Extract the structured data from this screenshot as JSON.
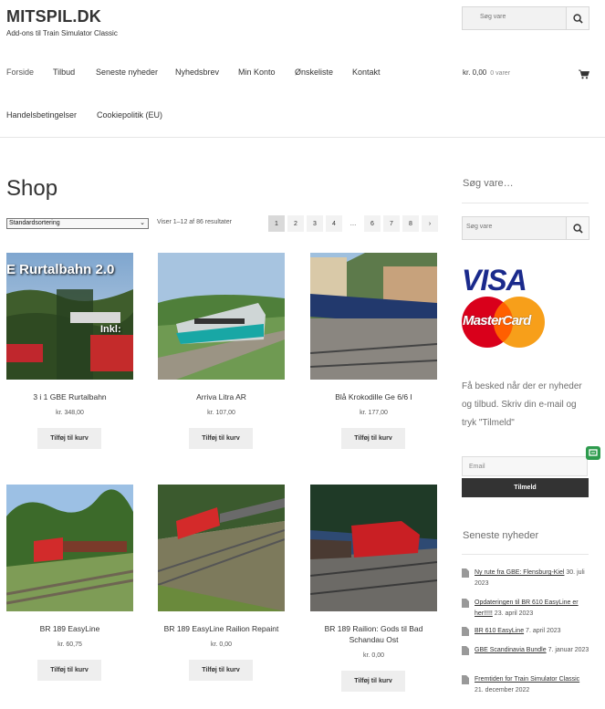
{
  "site": {
    "title": "MITSPIL.DK",
    "description": "Add-ons til Train Simulator Classic"
  },
  "search": {
    "placeholder": "Søg vare"
  },
  "nav": [
    "Forside",
    "Tilbud",
    "Seneste nyheder",
    "Nyhedsbrev",
    "Min Konto",
    "Ønskeliste",
    "Kontakt",
    "Handelsbetingelser",
    "Cookiepolitik (EU)"
  ],
  "cart": {
    "total": "kr. 0,00",
    "items": "0 varer"
  },
  "shop": {
    "title": "Shop",
    "sort_selected": "Standardsortering",
    "results": "Viser 1–12 af 86 resultater",
    "pagination": [
      "1",
      "2",
      "3",
      "4",
      "…",
      "6",
      "7",
      "8",
      "›"
    ]
  },
  "products": [
    {
      "name": "3 i 1 GBE Rurtalbahn",
      "price": "kr. 348,00",
      "button": "Tilføj til kurv",
      "img_text": "E Rurtalbahn 2.0",
      "img_text2": "Inkl:"
    },
    {
      "name": "Arriva Litra AR",
      "price": "kr. 107,00",
      "button": "Tilføj til kurv"
    },
    {
      "name": "Blå Krokodille Ge 6/6 I",
      "price": "kr. 177,00",
      "button": "Tilføj til kurv"
    },
    {
      "name": "BR 189 EasyLine",
      "price": "kr. 60,75",
      "button": "Tilføj til kurv"
    },
    {
      "name": "BR 189 EasyLine Railion Repaint",
      "price": "kr. 0,00",
      "button": "Tilføj til kurv"
    },
    {
      "name": "BR 189 Railion: Gods til Bad Schandau Ost",
      "price": "kr. 0,00",
      "button": "Tilføj til kurv"
    }
  ],
  "sidebar": {
    "search_heading": "Søg vare…",
    "search_placeholder": "Søg vare",
    "visa": "VISA",
    "mastercard": "MasterCard",
    "newsletter_text": "Få besked når der er nyheder og tilbud. Skriv din e-mail og tryk \"Tilmeld\"",
    "email_placeholder": "Email",
    "subscribe": "Tilmeld",
    "news_heading": "Seneste nyheder",
    "news": [
      {
        "title": "Ny rute fra GBE: Flensburg-Kiel",
        "date": "30. juli 2023"
      },
      {
        "title": "Opdateringen til BR 610 EasyLine er her!!!!!",
        "date": "23. april 2023"
      },
      {
        "title": "BR 610 EasyLine",
        "date": "7. april 2023"
      },
      {
        "title": "GBE Scandinavia Bundle",
        "date": "7. januar 2023"
      },
      {
        "title": "Fremtiden for Train Simulator Classic",
        "date": "21. december 2022"
      }
    ]
  },
  "colors": {
    "accent_dark": "#333333",
    "button_bg": "#eeeeee",
    "border": "#e6e6e6"
  }
}
